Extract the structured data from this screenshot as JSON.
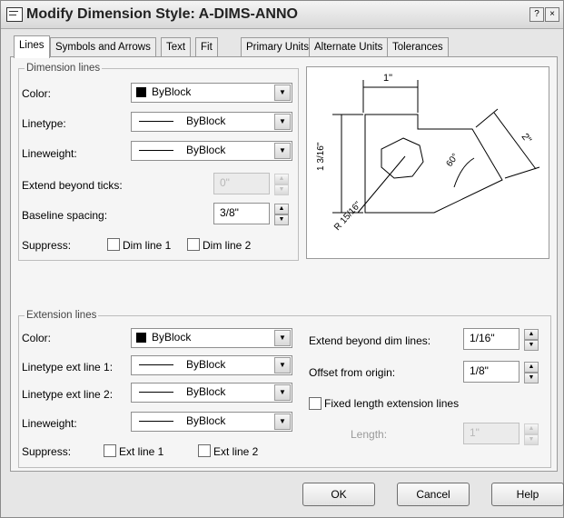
{
  "window": {
    "title": "Modify Dimension Style: A-DIMS-ANNO",
    "help_btn": "?",
    "close_btn": "×"
  },
  "tabs": [
    {
      "label": "Lines",
      "active": true
    },
    {
      "label": "Symbols and Arrows"
    },
    {
      "label": "Text"
    },
    {
      "label": "Fit"
    },
    {
      "label": "Primary Units"
    },
    {
      "label": "Alternate Units"
    },
    {
      "label": "Tolerances"
    }
  ],
  "dimension_lines": {
    "legend": "Dimension lines",
    "color_label": "Color:",
    "color_value": "ByBlock",
    "linetype_label": "Linetype:",
    "linetype_value": "ByBlock",
    "lineweight_label": "Lineweight:",
    "lineweight_value": "ByBlock",
    "extend_label": "Extend beyond ticks:",
    "extend_value": "0\"",
    "baseline_label": "Baseline spacing:",
    "baseline_value": "3/8\"",
    "suppress_label": "Suppress:",
    "dim1_label": "Dim line 1",
    "dim2_label": "Dim line 2"
  },
  "extension_lines": {
    "legend": "Extension lines",
    "color_label": "Color:",
    "color_value": "ByBlock",
    "ext1_label": "Linetype ext line 1:",
    "ext1_value": "ByBlock",
    "ext2_label": "Linetype ext line 2:",
    "ext2_value": "ByBlock",
    "lineweight_label": "Lineweight:",
    "lineweight_value": "ByBlock",
    "suppress_label": "Suppress:",
    "ext1_chk_label": "Ext line 1",
    "ext2_chk_label": "Ext line 2",
    "extend_beyond_label": "Extend beyond dim lines:",
    "extend_beyond_value": "1/16\"",
    "offset_label": "Offset from origin:",
    "offset_value": "1/8\"",
    "fixed_length_label": "Fixed length extension lines",
    "length_label": "Length:",
    "length_value": "1\""
  },
  "preview": {
    "dim_top": "1\"",
    "dim_left": "1 3/16\"",
    "dim_right": "2\"",
    "dim_angle": "60°",
    "dim_radius": "R 15/16\""
  },
  "buttons": {
    "ok": "OK",
    "cancel": "Cancel",
    "help": "Help"
  }
}
